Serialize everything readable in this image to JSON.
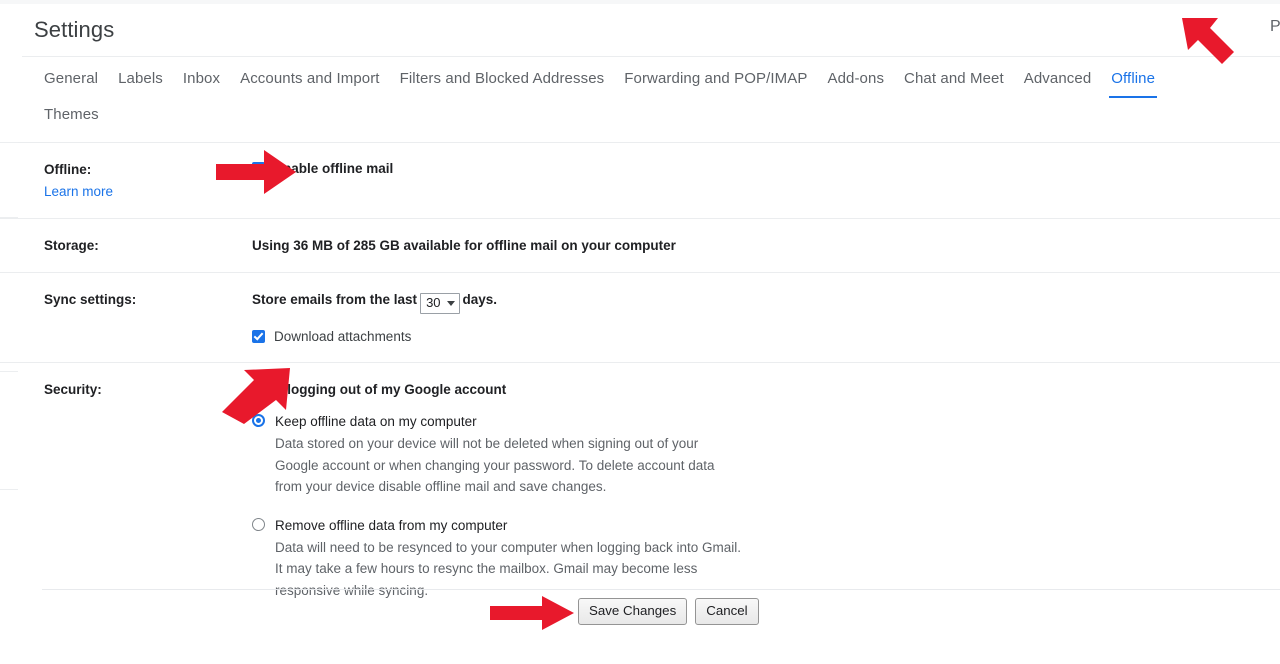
{
  "header": {
    "title": "Settings",
    "right_partial": "P"
  },
  "tabs": [
    {
      "label": "General",
      "active": false
    },
    {
      "label": "Labels",
      "active": false
    },
    {
      "label": "Inbox",
      "active": false
    },
    {
      "label": "Accounts and Import",
      "active": false
    },
    {
      "label": "Filters and Blocked Addresses",
      "active": false
    },
    {
      "label": "Forwarding and POP/IMAP",
      "active": false
    },
    {
      "label": "Add-ons",
      "active": false
    },
    {
      "label": "Chat and Meet",
      "active": false
    },
    {
      "label": "Advanced",
      "active": false
    },
    {
      "label": "Offline",
      "active": true
    },
    {
      "label": "Themes",
      "active": false
    }
  ],
  "rows": {
    "offline": {
      "label": "Offline:",
      "learn_more": "Learn more",
      "enable_checkbox_label": "Enable offline mail",
      "enable_checked": true
    },
    "storage": {
      "label": "Storage:",
      "value": "Using 36 MB of 285 GB available for offline mail on your computer"
    },
    "sync": {
      "label": "Sync settings:",
      "prefix": "Store emails from the last",
      "days_value": "30",
      "suffix": "days.",
      "attachments_label": "Download attachments",
      "attachments_checked": true
    },
    "security": {
      "label": "Security:",
      "heading": "After logging out of my Google account",
      "option_keep": {
        "title": "Keep offline data on my computer",
        "description": "Data stored on your device will not be deleted when signing out of your Google account or when changing your password. To delete account data from your device disable offline mail and save changes.",
        "selected": true
      },
      "option_remove": {
        "title": "Remove offline data from my computer",
        "description": "Data will need to be resynced to your computer when logging back into Gmail. It may take a few hours to resync the mailbox. Gmail may become less responsive while syncing.",
        "selected": false
      }
    }
  },
  "footer": {
    "save_label": "Save Changes",
    "cancel_label": "Cancel"
  },
  "annotations": {
    "accent_red": "#e8192c",
    "arrows": [
      {
        "name": "arrow-to-offline-tab",
        "points_at": "Offline"
      },
      {
        "name": "arrow-to-enable-offline-mail",
        "points_at": "Enable offline mail"
      },
      {
        "name": "arrow-to-keep-offline-data-radio",
        "points_at": "Keep offline data on my computer"
      },
      {
        "name": "arrow-to-save-changes",
        "points_at": "Save Changes"
      }
    ]
  },
  "colors": {
    "accent_blue": "#1a73e8",
    "text_primary": "#202124",
    "text_secondary": "#5f6368",
    "divider": "#ebedef"
  }
}
